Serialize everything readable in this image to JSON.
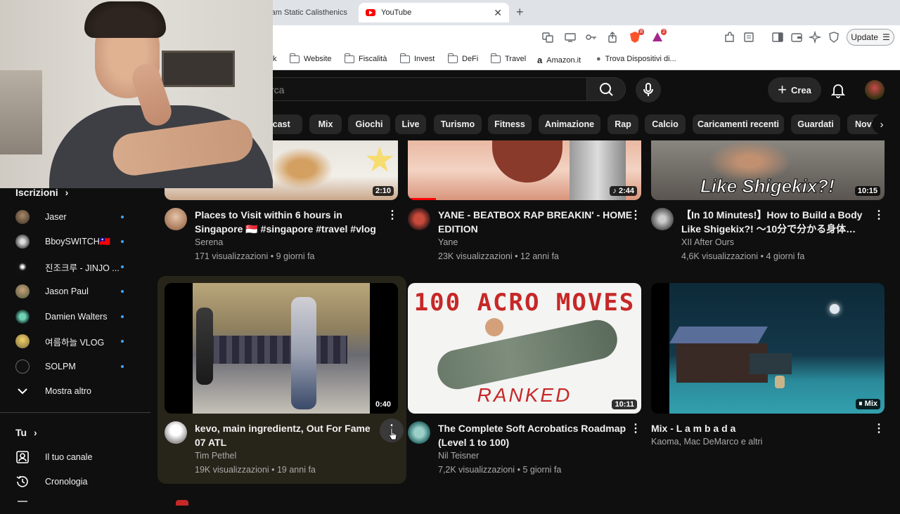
{
  "browser": {
    "tabs": [
      {
        "title": "ram Static Calisthenics"
      },
      {
        "title": "YouTube"
      }
    ],
    "new_tab_icon": "+",
    "toolbar": {
      "update_label": "Update",
      "extension_badge_1": "8",
      "extension_badge_2": "2"
    },
    "bookmarks": [
      {
        "label": "k",
        "icon": "folder-icon"
      },
      {
        "label": "Website",
        "icon": "folder-icon"
      },
      {
        "label": "Fiscalità",
        "icon": "folder-icon"
      },
      {
        "label": "Invest",
        "icon": "folder-icon"
      },
      {
        "label": "DeFi",
        "icon": "folder-icon"
      },
      {
        "label": "Travel",
        "icon": "folder-icon"
      },
      {
        "label": "Amazon.it",
        "icon": "amazon-icon"
      },
      {
        "label": "Trova Dispositivi di...",
        "icon": "apple-icon"
      }
    ]
  },
  "yt": {
    "search_placeholder": "rca",
    "create_label": "Crea",
    "chips": [
      "dcast",
      "Mix",
      "Giochi",
      "Live",
      "Turismo",
      "Fitness",
      "Animazione",
      "Rap",
      "Calcio",
      "Caricamenti recenti",
      "Guardati",
      "Novi"
    ],
    "sidebar": {
      "subscriptions_heading": "Iscrizioni",
      "channels": [
        {
          "name": "Jaser"
        },
        {
          "name": "BboySWITCH🇹🇼"
        },
        {
          "name": "진조크루 - JINJO ..."
        },
        {
          "name": "Jason Paul"
        },
        {
          "name": "Damien Walters"
        },
        {
          "name": "여름하늘 VLOG"
        },
        {
          "name": "SOLPM"
        }
      ],
      "show_more": "Mostra altro",
      "you_heading": "Tu",
      "your_channel": "Il tuo canale",
      "history": "Cronologia"
    },
    "videos": [
      {
        "title": "Places to Visit within 6 hours in Singapore 🇸🇬 #singapore #travel #vlog",
        "channel": "Serena",
        "views": "171 visualizzazioni",
        "age": "9 giorni fa",
        "duration": "2:10"
      },
      {
        "title": "YANE - BEATBOX RAP BREAKIN' - HOME EDITION",
        "channel": "Yane",
        "views": "23K visualizzazioni",
        "age": "12 anni fa",
        "duration": "♪ 2:44"
      },
      {
        "title": "【In 10 Minutes!】How to Build a Body Like Shigekix?! ～10分で分かる身体作…",
        "channel": "XII After Ours",
        "views": "4,6K visualizzazioni",
        "age": "4 giorni fa",
        "duration": "10:15",
        "thumb_text": "Like Shigekix?!"
      },
      {
        "title": "kevo, main ingredientz, Out For Fame 07 ATL",
        "channel": "Tim Pethel",
        "views": "19K visualizzazioni",
        "age": "19 anni fa",
        "duration": "0:40"
      },
      {
        "title": "The Complete Soft Acrobatics Roadmap (Level 1 to 100)",
        "channel": "Nil Teisner",
        "views": "7,2K visualizzazioni",
        "age": "5 giorni fa",
        "duration": "10:11",
        "thumb_text_top": "100 ACRO MOVES",
        "thumb_text_bottom": "RANKED"
      },
      {
        "title": "Mix - L a m b a d a",
        "channel": "Kaoma, Mac DeMarco e altri",
        "duration": "Mix"
      }
    ],
    "meta_separator": "•"
  }
}
